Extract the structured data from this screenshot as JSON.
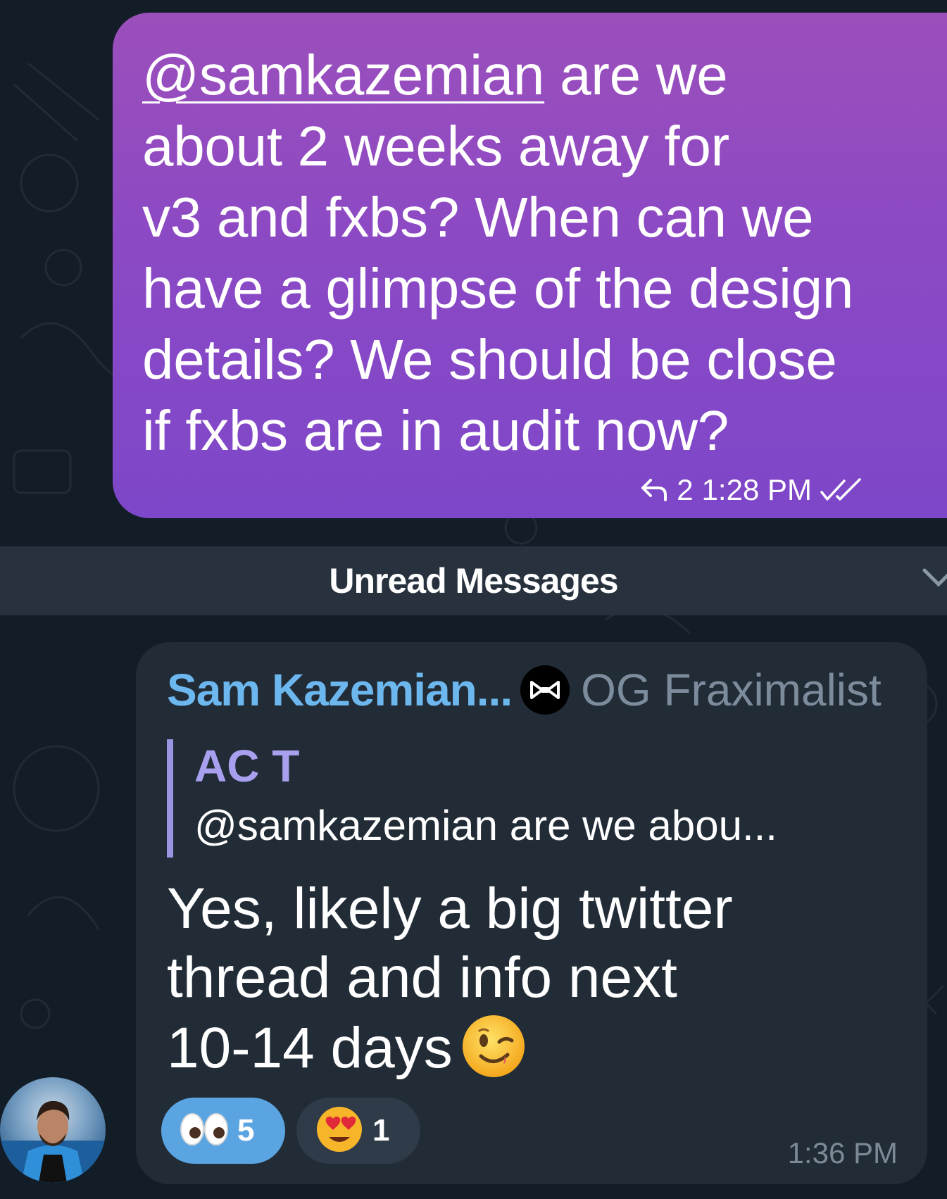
{
  "outgoing": {
    "mention": "@samkazemian",
    "text_after_mention": " are we\nabout 2 weeks away for\nv3 and fxbs? When can we\nhave a glimpse of the design\ndetails? We should be close\nif fxbs are in audit now?",
    "reply_count": "2",
    "time": "1:28 PM",
    "status_icon": "double-check-icon"
  },
  "divider": {
    "label": "Unread Messages"
  },
  "incoming": {
    "sender_name": "Sam Kazemian...",
    "sender_badge_icon": "bowtie-icon",
    "sender_title": "OG Fraximalist",
    "reply_to": {
      "author": "AC T",
      "text": "@samkazemian are we abou..."
    },
    "text": "Yes, likely a big twitter\nthread and info next\n10-14 days",
    "text_emoji": "winking-face-icon",
    "reactions": [
      {
        "emoji": "eyes-icon",
        "count": "5",
        "active": true
      },
      {
        "emoji": "heart-eyes-icon",
        "count": "1",
        "active": false
      }
    ],
    "time": "1:36 PM"
  },
  "colors": {
    "outgoing_bubble_top": "#9b4fbb",
    "outgoing_bubble_bottom": "#7d47c9",
    "incoming_bubble": "#222c37",
    "sender_name": "#6db7ef",
    "quote_accent": "#9a95e2",
    "background": "#131d27"
  }
}
